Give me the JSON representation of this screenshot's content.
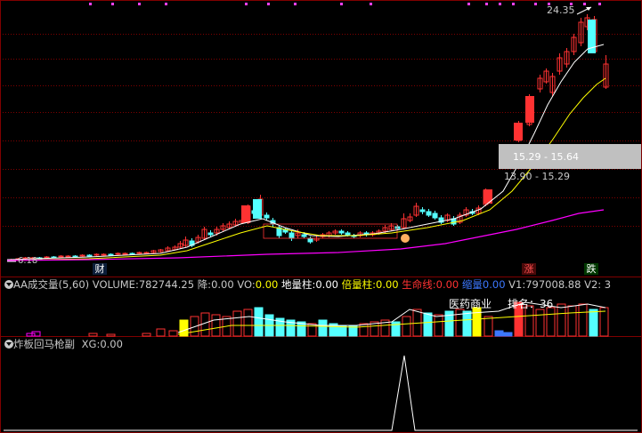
{
  "price_panel": {
    "high_label": "24.35",
    "box_label_a": "15.29 - 15.64",
    "box_label_b": "13.90 - 15.29",
    "low_label": "6.18",
    "marker_cai": "财",
    "marker_zhang": "涨",
    "marker_die": "跌"
  },
  "volume_panel": {
    "indicator_name": "AA成交量(5,60)",
    "volume_label": "VOLUME:",
    "volume_value": "782744.25",
    "jiang_label": "降:",
    "jiang_value": "0.00",
    "vo_label": "VO:",
    "vo_value": "0.00",
    "dilz_label": "地量柱:",
    "dilz_value": "0.00",
    "beilz_label": "倍量柱:",
    "beilz_value": "0.00",
    "smx_label": "生命线:",
    "smx_value": "0.00",
    "suolz_label": "缩量",
    "suolz_value": "0.00",
    "v1_label": "V1:",
    "v1_value": "797008.88",
    "v2_label": "V2: 3",
    "sector_label": "医药商业",
    "rank_label": "排名：",
    "rank_value": "36"
  },
  "indicator_panel": {
    "name": "炸板回马枪副",
    "xg_label": "XG:",
    "xg_value": "0.00"
  },
  "colors": {
    "up": "#ff3232",
    "down": "#54ffff",
    "ma_white": "#ffffff",
    "ma_yellow": "#ffff00",
    "ma_magenta": "#ff00ff",
    "grid": "#800000",
    "highlight": "#ffff00"
  }
}
